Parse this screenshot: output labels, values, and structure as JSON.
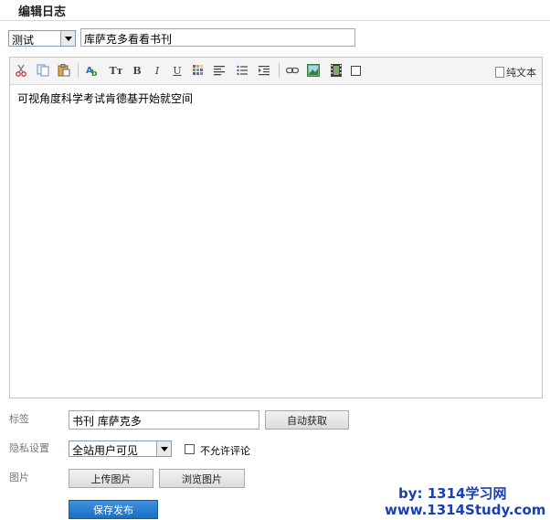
{
  "page_title": "编辑日志",
  "category_select": {
    "value": "测试"
  },
  "title_input": {
    "value": "库萨克多看看书刊"
  },
  "toolbar": {
    "icons": [
      "cut-icon",
      "copy-icon",
      "paste-icon",
      "find-icon",
      "font-size-icon",
      "bold-icon",
      "italic-icon",
      "underline-icon",
      "color-icon",
      "align-icon",
      "list-icon",
      "indent-icon",
      "link-icon",
      "image-icon",
      "video-icon",
      "checkbox-icon"
    ],
    "bold": "B",
    "italic": "I",
    "underline": "U",
    "font_size": "Tт",
    "plain_text": "纯文本"
  },
  "editor": {
    "content": "可视角度科学考试肯德基开始就空间"
  },
  "tags": {
    "label": "标签",
    "value": "书刊 库萨克多",
    "auto_button": "自动获取"
  },
  "privacy": {
    "label": "隐私设置",
    "value": "全站用户可见",
    "no_comment_label": "不允许评论",
    "no_comment_checked": false
  },
  "image": {
    "label": "图片",
    "upload_button": "上传图片",
    "browse_button": "浏览图片"
  },
  "submit": {
    "label": "保存发布"
  },
  "watermark": {
    "line1": "by: 1314学习网",
    "line2": "www.1314Study.com"
  }
}
